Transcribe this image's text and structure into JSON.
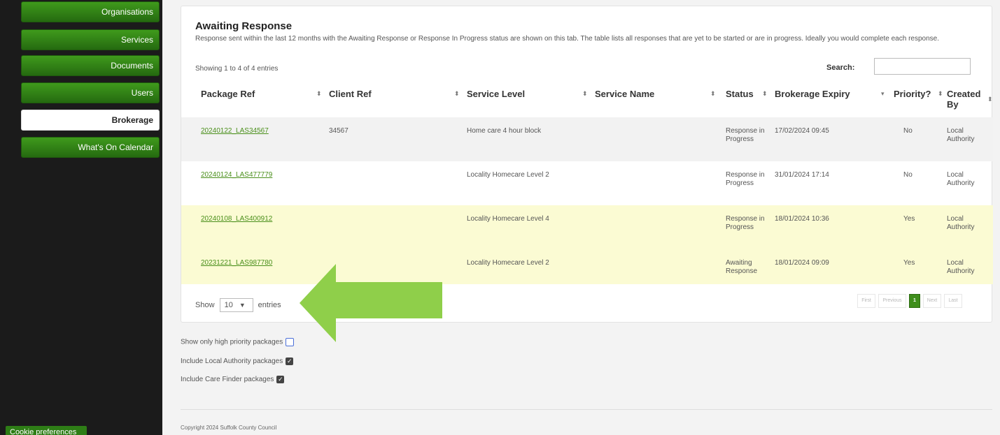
{
  "sidebar": {
    "items": [
      {
        "label": "Organisations"
      },
      {
        "label": "Services"
      },
      {
        "label": "Documents"
      },
      {
        "label": "Users"
      },
      {
        "label": "Brokerage"
      },
      {
        "label": "What's On Calendar"
      }
    ],
    "cookie_label": "Cookie preferences"
  },
  "panel": {
    "title": "Awaiting Response",
    "description": "Response sent within the last 12 months with the Awaiting Response or Response In Progress status are shown on this tab. The table lists all responses that are yet to be started or are in progress. Ideally you would complete each response.",
    "showing": "Showing 1 to 4 of 4 entries",
    "search_label": "Search:",
    "search_value": ""
  },
  "table": {
    "headers": [
      "Package Ref",
      "Client Ref",
      "Service Level",
      "Service Name",
      "Status",
      "Brokerage Expiry",
      "Priority?",
      "Created By"
    ],
    "rows": [
      {
        "package_ref": "20240122_LAS34567",
        "client_ref": "34567",
        "service_level": "Home care 4 hour block",
        "service_name": "",
        "status": "Response in Progress",
        "expiry": "17/02/2024 09:45",
        "priority": "No",
        "created_by": "Local Authority"
      },
      {
        "package_ref": "20240124_LAS477779",
        "client_ref": "",
        "service_level": "Locality Homecare Level 2",
        "service_name": "",
        "status": "Response in Progress",
        "expiry": "31/01/2024 17:14",
        "priority": "No",
        "created_by": "Local Authority"
      },
      {
        "package_ref": "20240108_LAS400912",
        "client_ref": "",
        "service_level": "Locality Homecare Level 4",
        "service_name": "",
        "status": "Response in Progress",
        "expiry": "18/01/2024 10:36",
        "priority": "Yes",
        "created_by": "Local Authority"
      },
      {
        "package_ref": "20231221_LAS987780",
        "client_ref": "",
        "service_level": "Locality Homecare Level 2",
        "service_name": "",
        "status": "Awaiting Response",
        "expiry": "18/01/2024 09:09",
        "priority": "Yes",
        "created_by": "Local Authority"
      }
    ]
  },
  "length_menu": {
    "show": "Show",
    "value": "10",
    "entries": "entries"
  },
  "pagination": {
    "first": "First",
    "previous": "Previous",
    "current": "1",
    "next": "Next",
    "last": "Last"
  },
  "filters": [
    {
      "label": "Show only high priority packages",
      "checked": false
    },
    {
      "label": "Include Local Authority packages",
      "checked": true
    },
    {
      "label": "Include Care Finder packages",
      "checked": true
    }
  ],
  "footer": {
    "copyright": "Copyright 2024 Suffolk County Council"
  },
  "colors": {
    "accent": "#3f9a1c",
    "highlight": "#fbfbd3",
    "arrow": "#8fcf4a"
  },
  "icons": {
    "sort": "sort-both-icon",
    "sort_active": "sort-desc-icon",
    "arrow": "arrow-left-icon",
    "dropdown": "chevron-down-icon"
  }
}
